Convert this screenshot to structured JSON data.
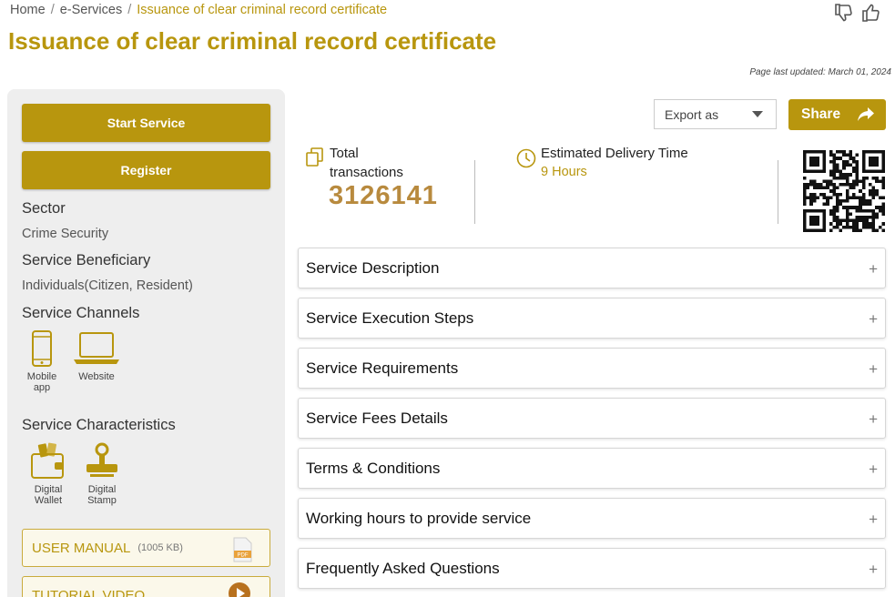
{
  "breadcrumb": {
    "home": "Home",
    "services": "e-Services",
    "current": "Issuance of clear criminal record certificate",
    "separator": "/"
  },
  "feedback": {
    "dislike_icon": "thumbs-down-icon",
    "like_icon": "thumbs-up-icon"
  },
  "page": {
    "title": "Issuance of clear criminal record certificate",
    "last_updated": "Page last updated: March 01, 2024"
  },
  "sidebar": {
    "start_label": "Start Service",
    "register_label": "Register",
    "sector_heading": "Sector",
    "sector_value": "Crime Security",
    "beneficiary_heading": "Service Beneficiary",
    "beneficiary_value": "Individuals(Citizen, Resident)",
    "channels_heading": "Service Channels",
    "channels": [
      {
        "label_line1": "Mobile",
        "label_line2": "app",
        "icon": "mobile-phone-icon"
      },
      {
        "label_line1": "Website",
        "label_line2": "",
        "icon": "laptop-icon"
      }
    ],
    "characteristics_heading": "Service Characteristics",
    "characteristics": [
      {
        "label_line1": "Digital",
        "label_line2": "Wallet",
        "icon": "wallet-icon"
      },
      {
        "label_line1": "Digital",
        "label_line2": "Stamp",
        "icon": "stamp-icon"
      }
    ],
    "manual_label": "USER MANUAL",
    "manual_size": "(1005 KB)",
    "manual_icon_text": "PDF",
    "tutorial_label": "TUTORIAL VIDEO"
  },
  "toolbar": {
    "export_label": "Export as",
    "share_label": "Share"
  },
  "stats": {
    "transactions_label_line1": "Total",
    "transactions_label_line2": "transactions",
    "transactions_value": "3126141",
    "delivery_label": "Estimated Delivery Time",
    "delivery_value": "9 Hours"
  },
  "accordion": [
    {
      "label": "Service Description"
    },
    {
      "label": "Service Execution Steps"
    },
    {
      "label": "Service Requirements"
    },
    {
      "label": "Service Fees Details"
    },
    {
      "label": "Terms & Conditions"
    },
    {
      "label": "Working hours to provide service"
    },
    {
      "label": "Frequently Asked Questions"
    }
  ],
  "accordion_expand_symbol": "+",
  "colors": {
    "accent": "#b8960e",
    "value": "#b88a3e",
    "sidebar_bg": "#eeeeee"
  }
}
